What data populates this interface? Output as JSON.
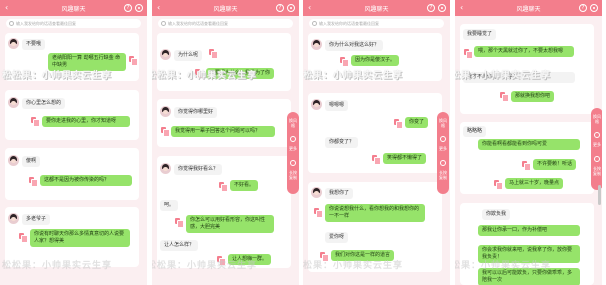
{
  "header": {
    "title": "风趣聊天",
    "back": "‹",
    "help": "?"
  },
  "search": {
    "placeholder": "输入我发给你的话语查看最佳回复"
  },
  "watermark": {
    "text": "松松果：小帅果实云生享"
  },
  "rail": {
    "items": [
      "换风格",
      "更多",
      "长按复制"
    ]
  },
  "panels": [
    {
      "messages": [
        {
          "side": "left",
          "text": "不要哦"
        },
        {
          "side": "right",
          "text": "老纳阳阳一算 劫哪五行缺金 命中缺男"
        },
        {
          "side": "left",
          "text": "你心里怎么想的"
        },
        {
          "side": "right",
          "text": "要你走进我的心里，你才知道呀"
        },
        {
          "side": "left",
          "text": "傻啊"
        },
        {
          "side": "right",
          "text": "这都不是因为被你传染的吗？"
        },
        {
          "side": "left",
          "text": "多老爷子"
        },
        {
          "side": "right",
          "text": "你说有时聊天你那么多情真意切的人说要人家？想得美"
        }
      ]
    },
    {
      "messages": [
        {
          "side": "left",
          "text": "为什么呢"
        },
        {
          "side": "right",
          "text": "不要问为什么，我是为了你"
        },
        {
          "side": "left",
          "text": "你觉得你哪里好"
        },
        {
          "side": "right",
          "text": "我觉得用一辈子回答这个问题可以吗？"
        },
        {
          "side": "left",
          "text": "你觉得我好看么？"
        },
        {
          "side": "right",
          "text": "不好看。"
        },
        {
          "side": "left",
          "text": "呵。"
        },
        {
          "side": "right",
          "text": "你怎么可以用好看形容，你这叫性感，大胆完美"
        },
        {
          "side": "left",
          "text": "让人怎么样？"
        },
        {
          "side": "right",
          "text": "让人想嗨一群。"
        }
      ]
    },
    {
      "messages": [
        {
          "side": "left",
          "text": "你为什么对我这么好？"
        },
        {
          "side": "right",
          "text": "因为你是傻汉子。"
        },
        {
          "side": "left",
          "text": "嗯嗯嗯"
        },
        {
          "side": "right",
          "text": "你变了"
        },
        {
          "side": "left",
          "text": "你都变了？"
        },
        {
          "side": "right",
          "text": "笑得都不懒得了"
        },
        {
          "side": "left",
          "text": "我想你了"
        },
        {
          "side": "right",
          "text": "你说说想我什么，看你想我的和我想你的一不一样"
        },
        {
          "side": "left",
          "text": "爱你呀"
        },
        {
          "side": "right",
          "text": "我们对你这是一样的道言"
        }
      ]
    },
    {
      "messages": [
        {
          "side": "left",
          "text": "我要睡觉了"
        },
        {
          "side": "right",
          "text": "喂，那个天黑就过你了，不要太想我嗯"
        },
        {
          "side": "left",
          "text": "我才不想你呢，想得美"
        },
        {
          "side": "right",
          "text": "那就换我想你吧"
        },
        {
          "side": "left",
          "text": "略略略"
        },
        {
          "side": "right",
          "text": "你能看啊看都能看到你吗可爱"
        },
        {
          "side": "right",
          "text": "不许要赖！听话"
        },
        {
          "side": "right",
          "text": "马上就三十岁，晚量点"
        },
        {
          "side": "left",
          "text": "你欺负我"
        },
        {
          "side": "right",
          "text": "那我让你承一口，作为补偿吧"
        },
        {
          "side": "right",
          "text": "你会求我你就来吧，说我拿了你，放你要我负责！"
        },
        {
          "side": "right",
          "text": "我可以以后可能欺负，只要你做乖乖，多陪我一次"
        }
      ]
    }
  ]
}
